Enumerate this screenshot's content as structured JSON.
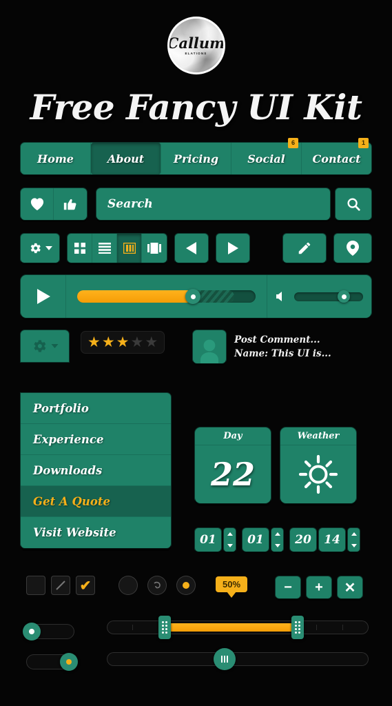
{
  "brand": {
    "logo_text": "Callum",
    "logo_sub": "ELATIONS",
    "logo_icon": "circle-cloud-badge"
  },
  "title": "Free Fancy UI Kit",
  "colors": {
    "green": "#1f8268",
    "green_dark": "#17624f",
    "gold": "#f5b01a",
    "background": "#050505",
    "text": "#ffffff"
  },
  "nav": {
    "items": [
      {
        "label": "Home",
        "active": false,
        "badge": ""
      },
      {
        "label": "About",
        "active": true,
        "badge": ""
      },
      {
        "label": "Pricing",
        "active": false,
        "badge": ""
      },
      {
        "label": "Social",
        "active": false,
        "badge": "6"
      },
      {
        "label": "Contact",
        "active": false,
        "badge": "1"
      }
    ]
  },
  "actions": {
    "heart_icon": "heart-icon",
    "thumbsup_icon": "thumbs-up-icon"
  },
  "search": {
    "placeholder": "Search",
    "value": "",
    "button_icon": "search-icon"
  },
  "toolbar": {
    "gear_icon": "gear-icon",
    "gear_caret": "chevron-down-icon",
    "views": [
      {
        "icon": "grid-view-icon",
        "active": false
      },
      {
        "icon": "list-view-icon",
        "active": false
      },
      {
        "icon": "column-view-icon",
        "active": true
      },
      {
        "icon": "gallery-view-icon",
        "active": false
      }
    ],
    "prev_icon": "arrow-left-icon",
    "next_icon": "arrow-right-icon",
    "edit_icon": "pencil-icon",
    "location_icon": "map-pin-icon"
  },
  "player": {
    "play_icon": "play-icon",
    "progress_percent": 65,
    "buffer_percent": 88,
    "volume_icon": "speaker-icon",
    "volume_percent": 72
  },
  "rating": {
    "value": 3,
    "max": 5,
    "star_icon": "star-icon"
  },
  "comment": {
    "avatar_icon": "user-avatar-icon",
    "line1": "Post Comment...",
    "line2": "Name: This UI is..."
  },
  "dropdown": {
    "gear_icon": "gear-icon",
    "caret_icon": "chevron-down-icon",
    "items": [
      {
        "label": "Portfolio",
        "active": false
      },
      {
        "label": "Experience",
        "active": false
      },
      {
        "label": "Downloads",
        "active": false
      },
      {
        "label": "Get A Quote",
        "active": true
      },
      {
        "label": "Visit Website",
        "active": false
      }
    ]
  },
  "widgets": [
    {
      "title": "Day",
      "value": "22",
      "icon": ""
    },
    {
      "title": "Weather",
      "value": "",
      "icon": "sun-icon"
    }
  ],
  "steppers": [
    {
      "value": "01"
    },
    {
      "value": "01"
    },
    {
      "value": "20"
    },
    {
      "value": "14"
    }
  ],
  "checkboxes": [
    {
      "state": "empty",
      "icon": ""
    },
    {
      "state": "partial",
      "icon": "slash-icon"
    },
    {
      "state": "checked",
      "icon": "check-icon"
    }
  ],
  "radios": [
    {
      "state": "empty",
      "icon": ""
    },
    {
      "state": "partial",
      "icon": "swirl-icon"
    },
    {
      "state": "checked",
      "icon": "dot-icon"
    }
  ],
  "tooltip": {
    "label": "50%"
  },
  "ops": [
    {
      "label": "−",
      "name": "minus-button"
    },
    {
      "label": "+",
      "name": "plus-button"
    },
    {
      "label": "✕",
      "name": "close-button"
    }
  ],
  "toggles": [
    {
      "state": "off",
      "knob_position_percent": 12,
      "dot_color": "#ffffff"
    },
    {
      "state": "on",
      "knob_position_percent": 88,
      "dot_color": "#f5b01a"
    }
  ],
  "range_slider": {
    "start_percent": 22,
    "end_percent": 73
  },
  "single_slider": {
    "value_percent": 45
  }
}
